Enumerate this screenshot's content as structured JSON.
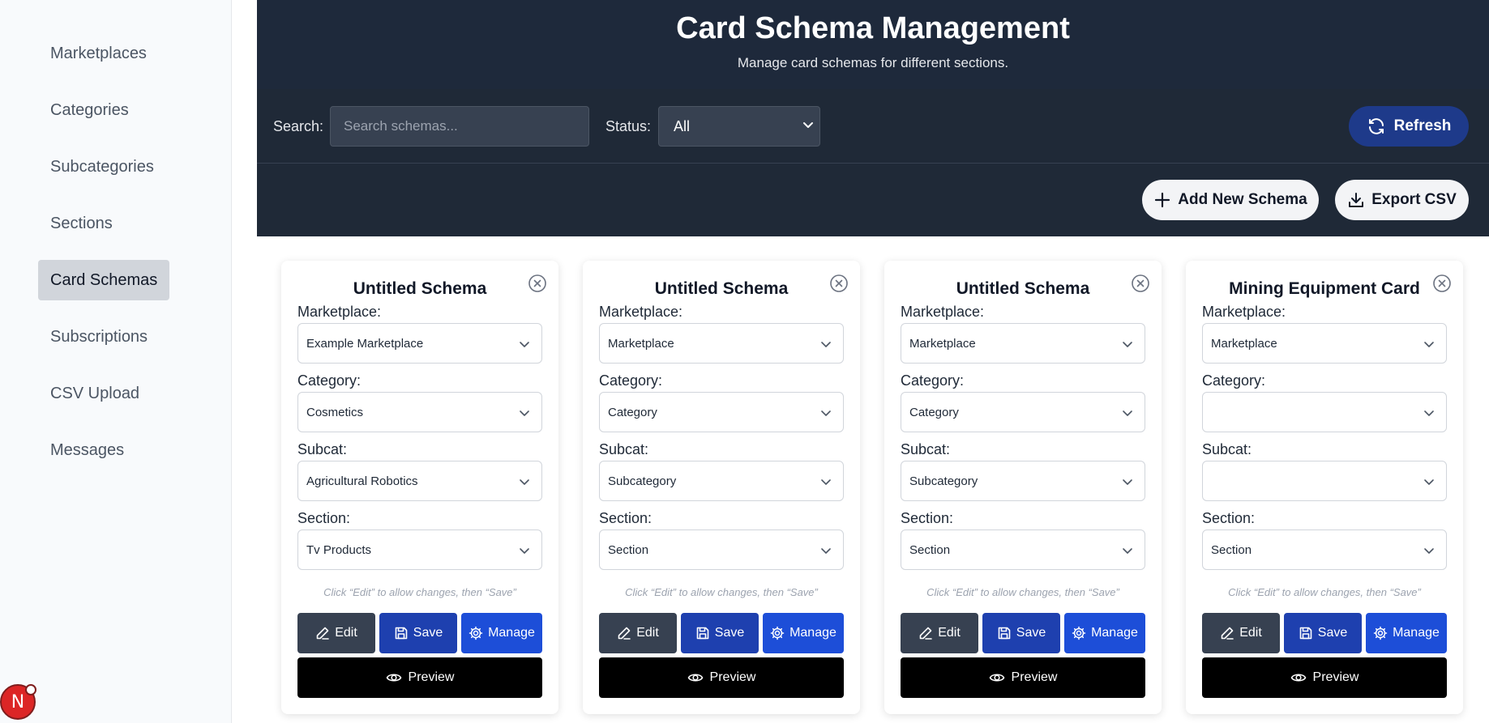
{
  "sidebar": {
    "items": [
      {
        "label": "Marketplaces"
      },
      {
        "label": "Categories"
      },
      {
        "label": "Subcategories"
      },
      {
        "label": "Sections"
      },
      {
        "label": "Card Schemas",
        "active": true
      },
      {
        "label": "Subscriptions"
      },
      {
        "label": "CSV Upload"
      },
      {
        "label": "Messages"
      }
    ],
    "avatar_letter": "N"
  },
  "header": {
    "title": "Card Schema Management",
    "subtitle": "Manage card schemas for different sections."
  },
  "toolbar": {
    "search_label": "Search:",
    "search_placeholder": "Search schemas...",
    "search_value": "",
    "status_label": "Status:",
    "status_value": "All",
    "refresh_label": "Refresh"
  },
  "actions": {
    "add_label": "Add New Schema",
    "export_label": "Export CSV"
  },
  "cards": [
    {
      "title": "Untitled Schema",
      "marketplace": "Example Marketplace",
      "category": "Cosmetics",
      "subcat": "Agricultural Robotics",
      "section": "Tv Products"
    },
    {
      "title": "Untitled Schema",
      "marketplace": "Marketplace",
      "category": "Category",
      "subcat": "Subcategory",
      "section": "Section"
    },
    {
      "title": "Untitled Schema",
      "marketplace": "Marketplace",
      "category": "Category",
      "subcat": "Subcategory",
      "section": "Section"
    },
    {
      "title": "Mining Equipment Card",
      "marketplace": "Marketplace",
      "category": "",
      "subcat": "",
      "section": "Section"
    }
  ],
  "card_labels": {
    "marketplace": "Marketplace:",
    "category": "Category:",
    "subcat": "Subcat:",
    "section": "Section:",
    "hint": "Click “Edit” to allow changes, then “Save”",
    "edit": "Edit",
    "save": "Save",
    "manage": "Manage",
    "preview": "Preview"
  },
  "colors": {
    "header_bg": "#1e293b",
    "toolbar_bg": "#1f2937",
    "refresh_bg": "#1e3a8a",
    "save_bg": "#1e40af",
    "manage_bg": "#1d4ed8",
    "edit_bg": "#374151",
    "preview_bg": "#000000",
    "avatar_bg": "#dc2626"
  }
}
